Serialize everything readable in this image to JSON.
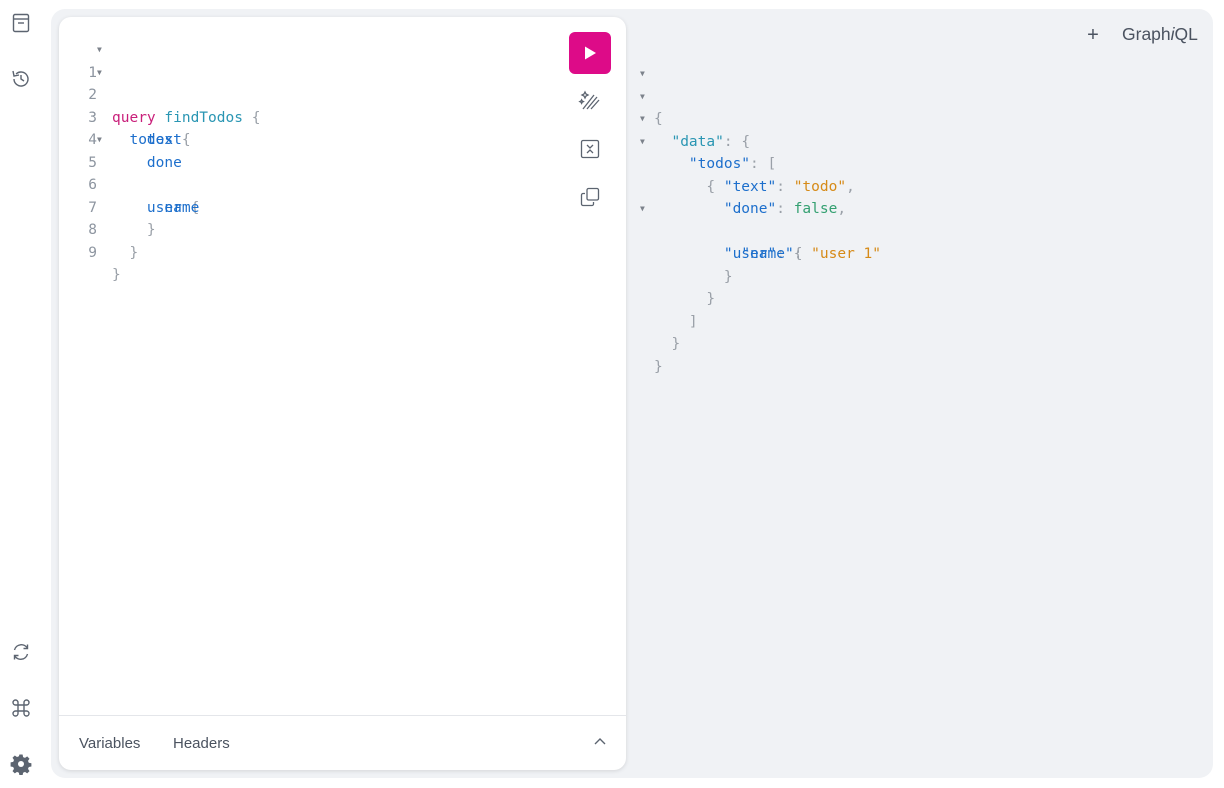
{
  "app": {
    "logo_prefix": "Graph",
    "logo_italic": "i",
    "logo_suffix": "QL",
    "new_tab_label": "+"
  },
  "sidebar": {
    "top_icons": [
      "docs-icon",
      "history-icon"
    ],
    "bottom_icons": [
      "refetch-icon",
      "shortcuts-icon",
      "settings-icon"
    ]
  },
  "editor": {
    "line_numbers": [
      "1",
      "2",
      "3",
      "4",
      "5",
      "6",
      "7",
      "8",
      "9"
    ],
    "lines": [
      {
        "keyword": "query",
        "name": "findTodos",
        "open": "{"
      },
      {
        "field": "todos",
        "open": "{"
      },
      {
        "field": "text"
      },
      {
        "field": "done"
      },
      {
        "field": "user",
        "open": "{"
      },
      {
        "field": "name"
      },
      {
        "close": "}"
      },
      {
        "close": "}"
      },
      {
        "close": "}"
      }
    ],
    "tools": [
      "run-icon",
      "prettify-icon",
      "merge-fragments-icon",
      "copy-icon"
    ]
  },
  "bottom": {
    "variables_tab": "Variables",
    "headers_tab": "Headers"
  },
  "result": {
    "open_brace": "{",
    "data_key": "\"data\"",
    "todos_key": "\"todos\"",
    "text_key": "\"text\"",
    "text_value": "\"todo\"",
    "done_key": "\"done\"",
    "done_value": "false",
    "user_key": "\"user\"",
    "name_key": "\"name\"",
    "name_value": "\"user 1\""
  },
  "colors": {
    "accent": "#dd0b88",
    "panel_bg": "#f0f2f5",
    "keyword": "#c91f7a",
    "field": "#1d6fcc",
    "string": "#d68a17",
    "boolean": "#34a071"
  }
}
